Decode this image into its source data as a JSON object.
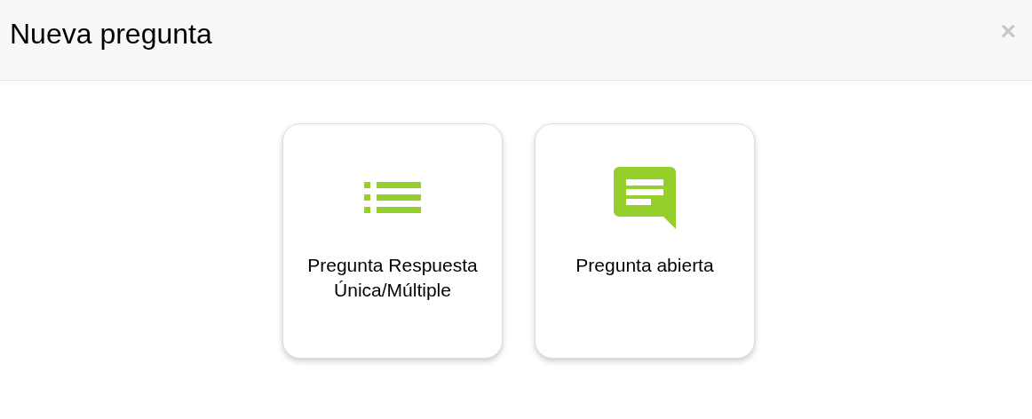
{
  "dialog": {
    "title": "Nueva pregunta",
    "close": "×"
  },
  "options": [
    {
      "kind": "list",
      "label": "Pregunta Respuesta Única/Múltiple"
    },
    {
      "kind": "comment",
      "label": "Pregunta abierta"
    }
  ]
}
